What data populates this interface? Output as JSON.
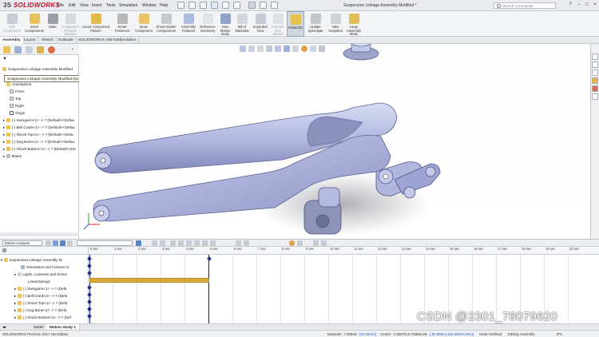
{
  "app": {
    "logo_brand": "SOLIDWORKS",
    "logo_prefix": "3S",
    "document_title": "Suspension Linkage Assembly Modified *",
    "search_placeholder": "Search Commands"
  },
  "menu": [
    "File",
    "Edit",
    "View",
    "Insert",
    "Tools",
    "Simulation",
    "Window",
    "Help"
  ],
  "commands": [
    {
      "label": "Edit Component",
      "icon": "edit-component-icon"
    },
    {
      "label": "Insert Components",
      "icon": "insert-components-icon"
    },
    {
      "label": "Mate",
      "icon": "mate-icon"
    },
    {
      "label": "Component Preview Window",
      "icon": "preview-window-icon"
    },
    {
      "label": "Linear Component Pattern",
      "icon": "pattern-icon"
    },
    {
      "label": "Smart Fasteners",
      "icon": "fasteners-icon"
    },
    {
      "label": "Move Component",
      "icon": "move-component-icon"
    },
    {
      "label": "Show Hidden Components",
      "icon": "show-hidden-icon"
    },
    {
      "label": "Assembly Features",
      "icon": "assembly-features-icon"
    },
    {
      "label": "Reference Geometry",
      "icon": "reference-geometry-icon"
    },
    {
      "label": "New Motion Study",
      "icon": "motion-study-icon"
    },
    {
      "label": "Bill of Materials",
      "icon": "bom-icon"
    },
    {
      "label": "Exploded View",
      "icon": "exploded-view-icon"
    },
    {
      "label": "Explode Line Sketch",
      "icon": "explode-line-icon"
    },
    {
      "label": "Instant3D",
      "icon": "instant3d-icon"
    },
    {
      "label": "Update Speedpak",
      "icon": "speedpak-icon"
    },
    {
      "label": "Take Snapshot",
      "icon": "snapshot-icon"
    },
    {
      "label": "Large Assembly Mode",
      "icon": "large-assembly-icon"
    }
  ],
  "tabs": [
    "Assembly",
    "Layout",
    "Sketch",
    "Evaluate",
    "SOLIDWORKS Add-Ins",
    "Simulation"
  ],
  "feature_tree": {
    "root": "Suspension Linkage Assembly Modified",
    "tooltip": "Suspension Linkage Assembly Modified (Default<Default_Display State-1>)",
    "items": [
      "Annotations",
      "Front",
      "Top",
      "Right",
      "Origin",
      "(-) Swingarm<1> -> ? (Default<<Defau",
      "(-) Bell Crank<1> -> ? (Default<<Defau",
      "(-) Shock Top<1> -> ? (Default<<Defa",
      "(-) Dog Bone<1> -> ? (Default<<Defau",
      "(-) Shock Bottom<1> -> ? (Default<<De",
      "Mates"
    ]
  },
  "motion": {
    "study_type": "Motion Analysis",
    "tree": [
      "Suspension Linkage Assembly M",
      "Orientation and Camera Vi",
      "Lights, Cameras and Scene",
      "LinearSpring1",
      "(-) Swingarm<1> -> ? (Defa",
      "(-) Bell Crank<1> -> ? (Defa",
      "(-) Shock Top<1> -> ? (Defa",
      "(-) Dog Bone<1> -> ? (Defa",
      "(-) Shock Bottom<1> -> ? (Def"
    ],
    "ticks": [
      "0 sec",
      "1 sec",
      "2 sec",
      "3 sec",
      "4 sec",
      "5 sec",
      "6 sec",
      "7 sec",
      "8 sec",
      "9 sec",
      "10 sec",
      "11 sec",
      "12 sec",
      "13 sec",
      "14 sec",
      "15 sec",
      "16 sec",
      "17 sec",
      "18 sec",
      "19 sec",
      "20 sec"
    ],
    "study_tabs": [
      "Model",
      "Motion Study 1"
    ]
  },
  "status": {
    "edition": "SOLIDWORKS Premium 2017 x64 Edition",
    "diameter": "Diameter: 7.0000in",
    "diameter_mm": "[10.00mm]",
    "center": "Center: -2.0807in,8.7588in,0in",
    "center_mm": "[-52.85mm,222.48mm,0mm]",
    "state": "Under Defined",
    "mode": "Editing Assembly",
    "units": "IPS"
  },
  "watermark": "CSDN @2301_78079620",
  "colors": {
    "part": "#b9bfe4",
    "spring_bar": "#d4a93a",
    "key": "#1c2f8c",
    "brand": "#c8102e"
  }
}
